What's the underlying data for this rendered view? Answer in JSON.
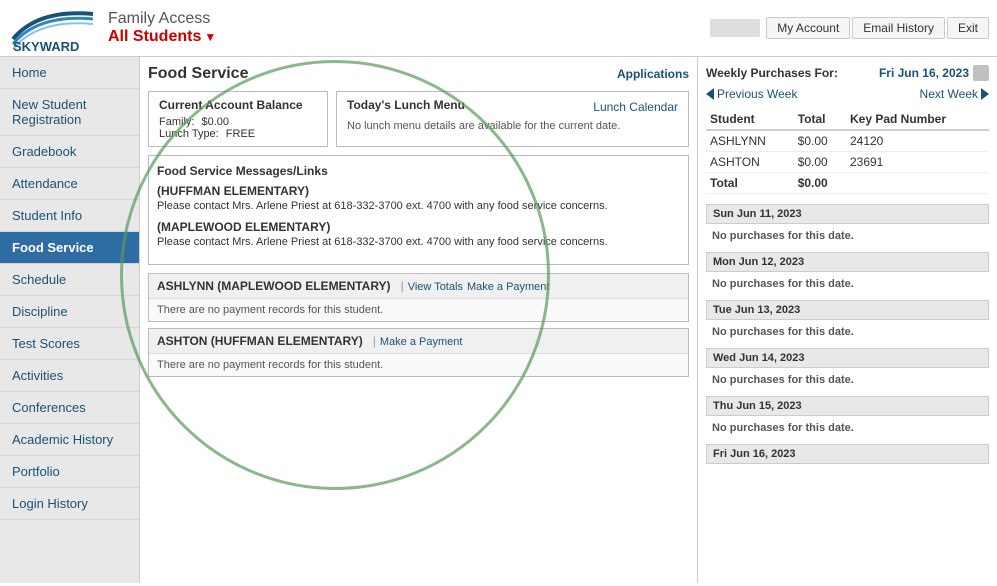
{
  "header": {
    "logo_text": "SKYWARD",
    "app_title": "Family Access",
    "all_students_label": "All Students",
    "nav": {
      "account_label": "My Account",
      "email_history_label": "Email History",
      "exit_label": "Exit"
    }
  },
  "sidebar": {
    "items": [
      {
        "label": "Home",
        "active": false
      },
      {
        "label": "New Student Registration",
        "active": false
      },
      {
        "label": "Gradebook",
        "active": false
      },
      {
        "label": "Attendance",
        "active": false
      },
      {
        "label": "Student Info",
        "active": false
      },
      {
        "label": "Food Service",
        "active": true
      },
      {
        "label": "Schedule",
        "active": false
      },
      {
        "label": "Discipline",
        "active": false
      },
      {
        "label": "Test Scores",
        "active": false
      },
      {
        "label": "Activities",
        "active": false
      },
      {
        "label": "Conferences",
        "active": false
      },
      {
        "label": "Academic History",
        "active": false
      },
      {
        "label": "Portfolio",
        "active": false
      },
      {
        "label": "Login History",
        "active": false
      }
    ]
  },
  "main": {
    "page_title": "Food Service",
    "applications_link": "Applications",
    "current_balance": {
      "title": "Current Account Balance",
      "family_label": "Family:",
      "family_value": "$0.00",
      "lunch_type_label": "Lunch Type:",
      "lunch_type_value": "FREE"
    },
    "lunch_menu": {
      "title": "Today's Lunch Menu",
      "calendar_link": "Lunch Calendar",
      "message": "No lunch menu details are available for the current date."
    },
    "messages_title": "Food Service Messages/Links",
    "schools": [
      {
        "name": "(HUFFMAN ELEMENTARY)",
        "message": "Please contact Mrs. Arlene Priest at 618-332-3700 ext. 4700 with any food service concerns."
      },
      {
        "name": "(MAPLEWOOD ELEMENTARY)",
        "message": "Please contact Mrs. Arlene Priest at 618-332-3700 ext. 4700 with any food service concerns."
      }
    ],
    "students": [
      {
        "name": "ASHLYNN (MAPLEWOOD ELEMENTARY)",
        "links": [
          {
            "label": "View Totals",
            "separator": "| "
          },
          {
            "label": "Make a Payment",
            "separator": ""
          }
        ],
        "no_records": "There are no payment records for this student."
      },
      {
        "name": "ASHTON (HUFFMAN ELEMENTARY)",
        "links": [
          {
            "label": "Make a Payment",
            "separator": "| "
          }
        ],
        "no_records": "There are no payment records for this student."
      }
    ]
  },
  "right_panel": {
    "weekly_purchases_title": "Weekly Purchases For:",
    "weekly_date": "Fri Jun 16, 2023",
    "prev_week_label": "Previous Week",
    "next_week_label": "Next Week",
    "table_headers": [
      "Student",
      "Total",
      "Key Pad Number"
    ],
    "students": [
      {
        "name": "ASHLYNN",
        "total": "$0.00",
        "keypad": "24120"
      },
      {
        "name": "ASHTON",
        "total": "$0.00",
        "keypad": "23691"
      }
    ],
    "total_row": {
      "label": "Total",
      "total": "$0.00"
    },
    "dates": [
      {
        "date": "Sun Jun 11, 2023",
        "message": "No purchases for this date."
      },
      {
        "date": "Mon Jun 12, 2023",
        "message": "No purchases for this date."
      },
      {
        "date": "Tue Jun 13, 2023",
        "message": "No purchases for this date."
      },
      {
        "date": "Wed Jun 14, 2023",
        "message": "No purchases for this date."
      },
      {
        "date": "Thu Jun 15, 2023",
        "message": "No purchases for this date."
      },
      {
        "date": "Fri Jun 16, 2023",
        "message": ""
      }
    ]
  }
}
